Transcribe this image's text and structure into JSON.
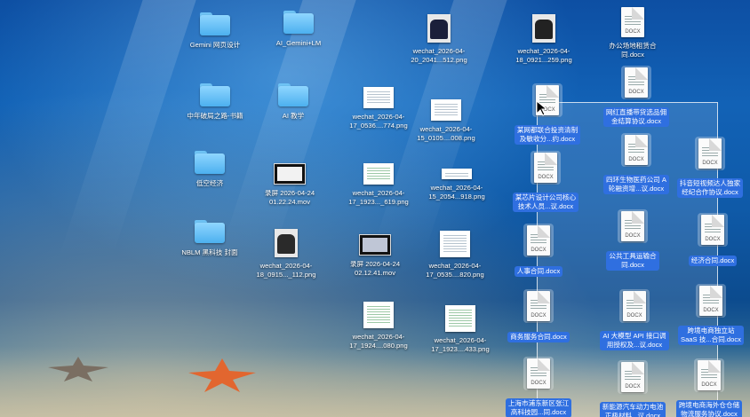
{
  "colors": {
    "selection": "#2f6fe0",
    "folder": "#6ec3f5",
    "desktop": "#1262b6"
  },
  "desktop": {
    "folders": [
      {
        "label": "Gemini 网页设计",
        "icon": "folder-icon"
      },
      {
        "label": "AI_Gemini+LM",
        "icon": "folder-icon"
      },
      {
        "label": "中年破局之路-书籍",
        "icon": "folder-icon"
      },
      {
        "label": "AI 教学",
        "icon": "folder-icon"
      },
      {
        "label": "低空经济",
        "icon": "folder-icon"
      },
      {
        "label": "NBLM 黑科技 封面",
        "icon": "folder-icon"
      }
    ],
    "files": [
      {
        "label": "wechat_2026-04-\n20_2041...512.png",
        "icon": "photo-icon"
      },
      {
        "label": "wechat_2026-04-\n18_0921...259.png",
        "icon": "photo-icon"
      },
      {
        "label": "办公场地租赁合\n同.docx",
        "icon": "docx-icon"
      },
      {
        "label": "wechat_2026-04-\n17_0536....774.png",
        "icon": "screenshot-icon"
      },
      {
        "label": "wechat_2026-04-\n15_0105....008.png",
        "icon": "screenshot-icon"
      },
      {
        "label": "录屏 2026-04-24\n01.22.24.mov",
        "icon": "movie-icon"
      },
      {
        "label": "wechat_2026-04-\n17_1923..._619.png",
        "icon": "screenshot-icon"
      },
      {
        "label": "wechat_2026-04-\n15_2054...918.png",
        "icon": "screenshot-icon"
      },
      {
        "label": "wechat_2026-04-\n18_0915..._112.png",
        "icon": "photo-icon"
      },
      {
        "label": "录屏 2026-04-24\n02.12.41.mov",
        "icon": "movie-icon"
      },
      {
        "label": "wechat_2026-04-\n17_0535....820.png",
        "icon": "screenshot-icon"
      },
      {
        "label": "wechat_2026-04-\n17_1924....080.png",
        "icon": "screenshot-icon"
      },
      {
        "label": "wechat_2026-04-\n17_1923....433.png",
        "icon": "screenshot-icon"
      }
    ],
    "selected_files": [
      {
        "label": "网红直播带货选品佣\n金结算协议.docx",
        "icon": "docx-icon"
      },
      {
        "label": "某网都联合投资清制\n及敏收分...约.docx",
        "icon": "docx-icon"
      },
      {
        "label": "四环生物医药公司 A\n轮融资增...议.docx",
        "icon": "docx-icon"
      },
      {
        "label": "抖音短视频达人独家\n经纪合作协议.docx",
        "icon": "docx-icon"
      },
      {
        "label": "某芯片设计公司核心\n技术人员...议.docx",
        "icon": "docx-icon"
      },
      {
        "label": "公共工具运输合\n同.docx",
        "icon": "docx-icon"
      },
      {
        "label": "经济合同.docx",
        "icon": "docx-icon"
      },
      {
        "label": "人事合同.docx",
        "icon": "docx-icon"
      },
      {
        "label": "商务服务合同.docx",
        "icon": "docx-icon"
      },
      {
        "label": "AI 大模型 API 接口调\n用授权及...议.docx",
        "icon": "docx-icon"
      },
      {
        "label": "跨境电商独立站\nSaaS 技...合同.docx",
        "icon": "docx-icon"
      },
      {
        "label": "上海市浦东新区张江\n高科技园...同.docx",
        "icon": "docx-icon"
      },
      {
        "label": "新能源汽车动力电池\n正极材料...议.docx",
        "icon": "docx-icon"
      },
      {
        "label": "跨境电商海外仓仓储\n物流服务协议.docx",
        "icon": "docx-icon"
      }
    ],
    "doc_ext": "DOCX"
  }
}
